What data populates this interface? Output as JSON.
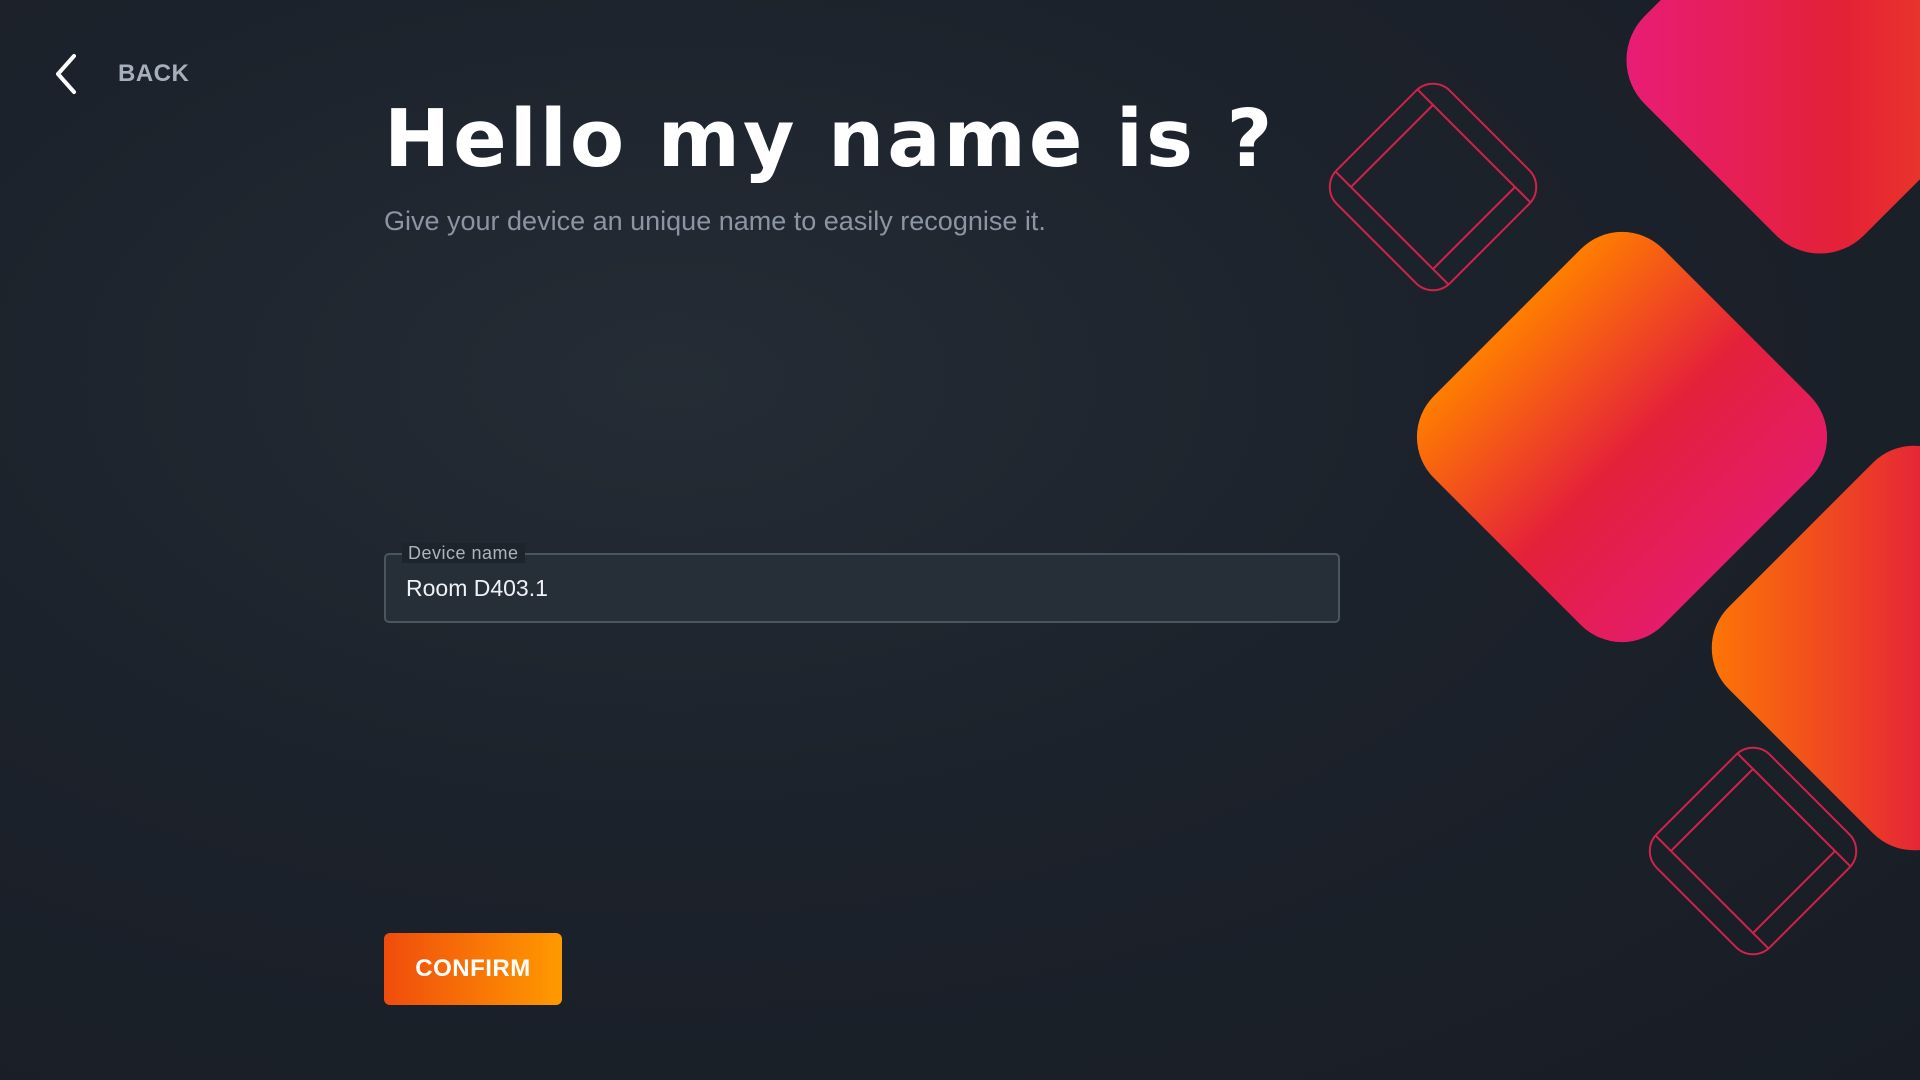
{
  "header": {
    "back_label": "BACK",
    "back_icon": "chevron-left-icon"
  },
  "main": {
    "title": "Hello my name is ?",
    "subtitle": "Give your device an unique name to easily recognise it."
  },
  "form": {
    "device_name": {
      "label": "Device name",
      "value": "Room D403.1"
    },
    "confirm_label": "CONFIRM"
  },
  "colors": {
    "background": "#1c222b",
    "accent_orange": "#ff7a00",
    "accent_red": "#e41e36",
    "accent_pink": "#e81c7e",
    "field_border": "#4b5562"
  }
}
